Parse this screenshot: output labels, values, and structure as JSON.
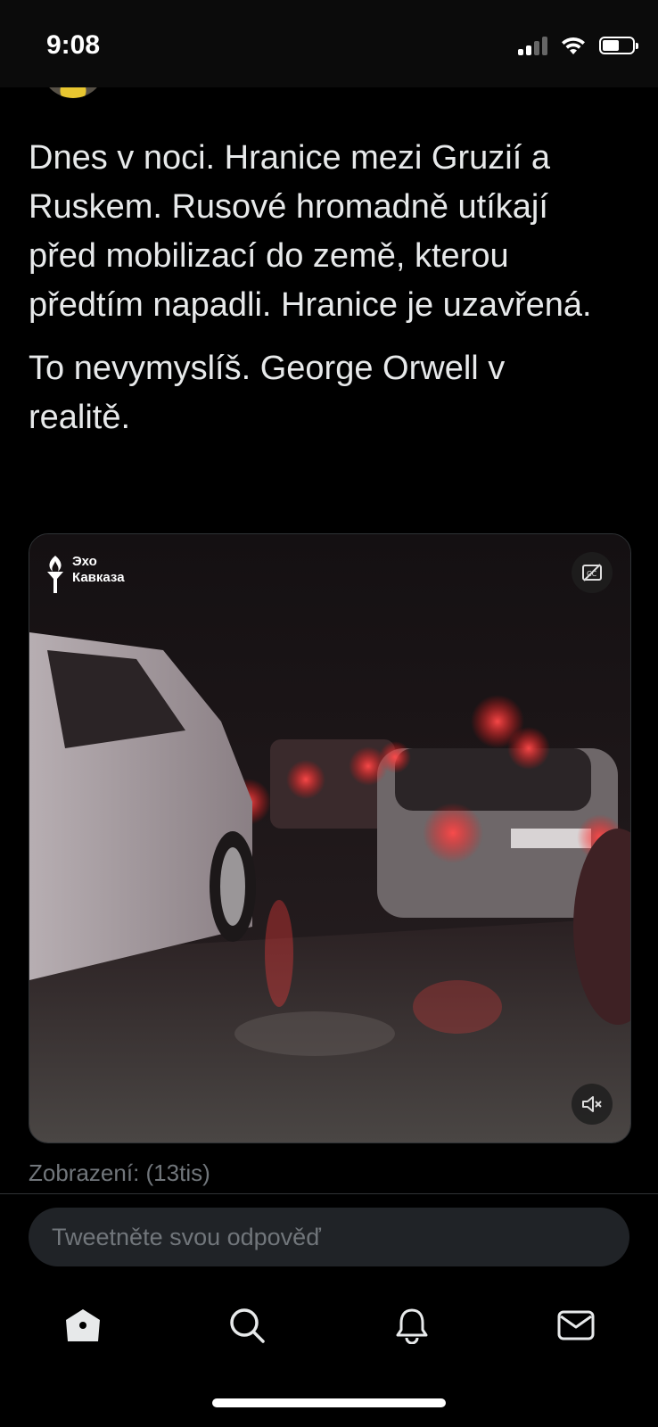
{
  "status_bar": {
    "time": "9:08",
    "icons": [
      "cellular-signal-icon",
      "wifi-icon",
      "battery-icon"
    ]
  },
  "tweet": {
    "paragraphs": [
      "Dnes v noci. Hranice mezi Gruzií a Ruskem. Rusové hromadně utíkají před mobilizací do země, kterou předtím napadli. Hranice je uzavřená.",
      "To nevymyslíš.  George Orwell v realitě."
    ]
  },
  "media": {
    "logo_line1": "Эхо",
    "logo_line2": "Кавказа",
    "cc_icon": "captions-off-icon",
    "mute_icon": "volume-muted-icon"
  },
  "views_text": "Zobrazení: (13tis)",
  "reply": {
    "placeholder": "Tweetněte svou odpověď"
  },
  "tab_bar": {
    "items": [
      {
        "icon": "home-icon",
        "active": true
      },
      {
        "icon": "search-icon",
        "active": false
      },
      {
        "icon": "bell-icon",
        "active": false
      },
      {
        "icon": "mail-icon",
        "active": false
      }
    ]
  },
  "colors": {
    "background": "#000000",
    "text": "#e7e9ea",
    "secondary_text": "#71767b",
    "reply_box": "#202327"
  }
}
